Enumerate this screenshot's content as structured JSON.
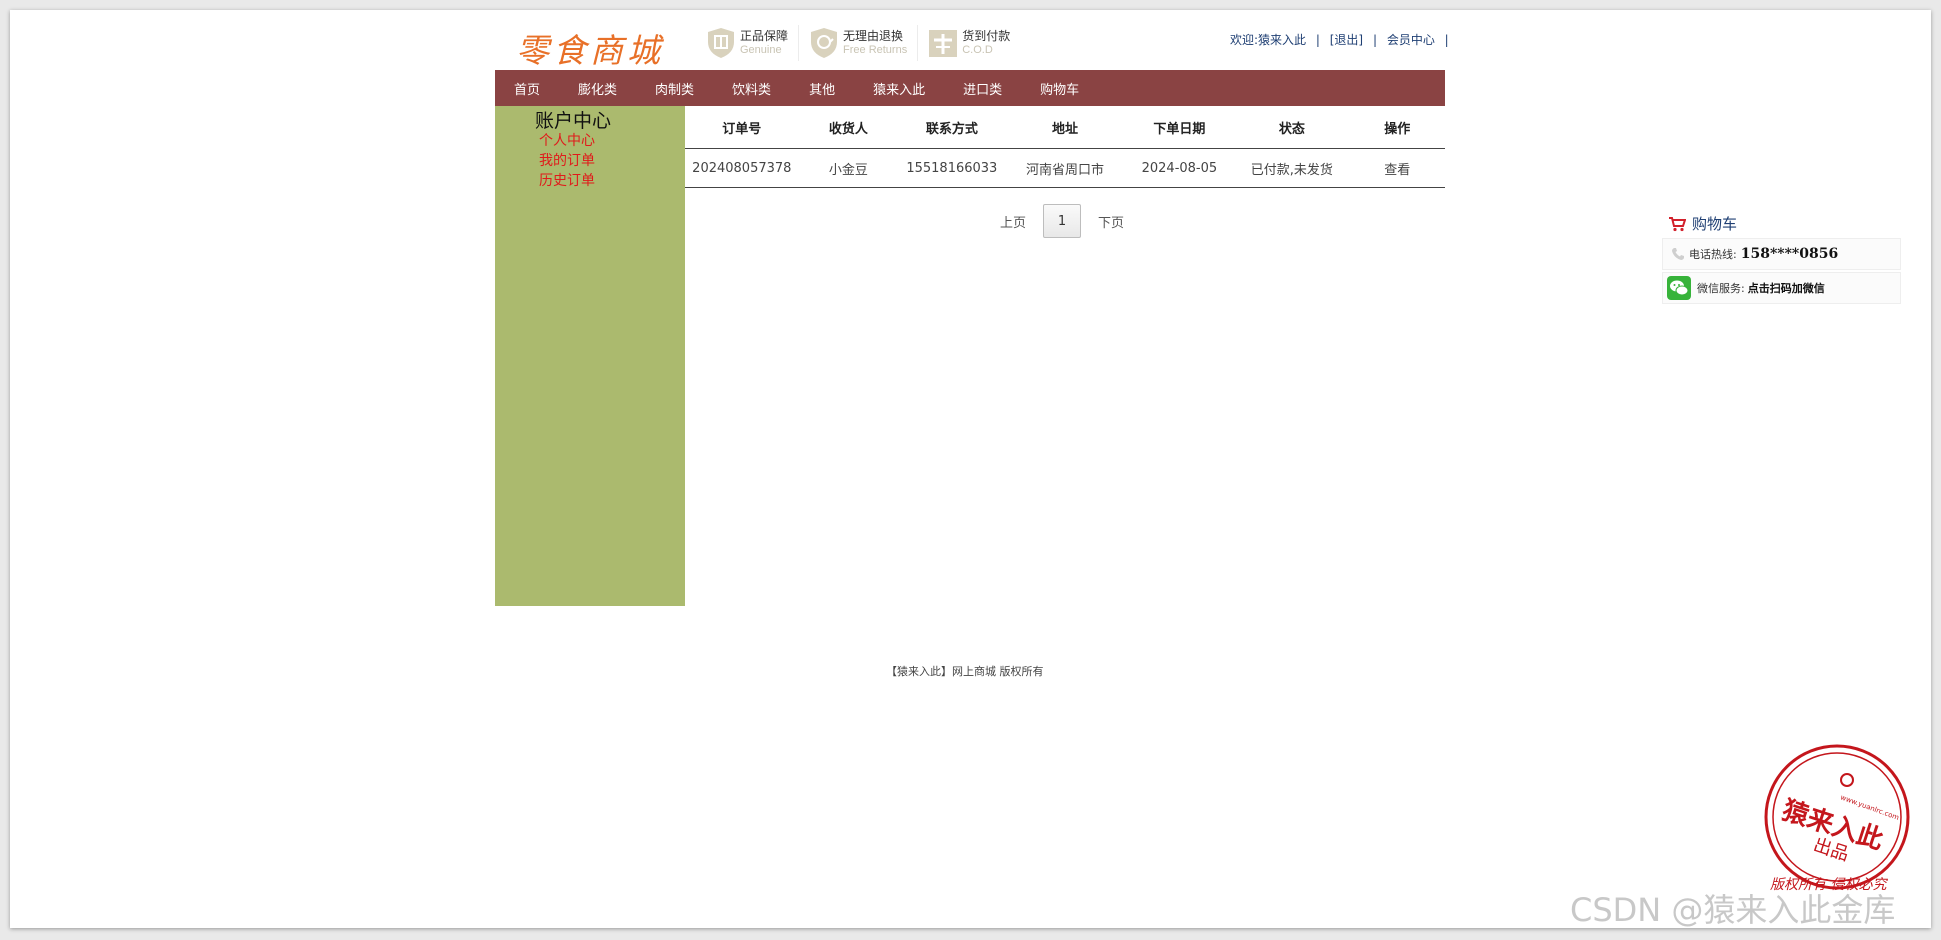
{
  "header": {
    "logo": "零食商城",
    "badges": [
      {
        "icon": "shield-genuine-icon",
        "title": "正品保障",
        "sub": "Genuine"
      },
      {
        "icon": "shield-return-icon",
        "title": "无理由退换",
        "sub": "Free Returns"
      },
      {
        "icon": "cod-icon",
        "title": "货到付款",
        "sub": "C.O.D"
      }
    ],
    "user": {
      "welcome": "欢迎:猿来入此",
      "logout": "[退出]",
      "member_center": "会员中心"
    }
  },
  "nav": [
    "首页",
    "膨化类",
    "肉制类",
    "饮料类",
    "其他",
    "猿来入此",
    "进口类",
    "购物车"
  ],
  "sidebar": {
    "title": "账户中心",
    "links": [
      "个人中心",
      "我的订单",
      "历史订单"
    ]
  },
  "orders": {
    "columns": [
      "订单号",
      "收货人",
      "联系方式",
      "地址",
      "下单日期",
      "状态",
      "操作"
    ],
    "rows": [
      [
        "202408057378",
        "小金豆",
        "15518166033",
        "河南省周口市",
        "2024-08-05",
        "已付款,未发货",
        "查看"
      ]
    ]
  },
  "pager": {
    "prev": "上页",
    "current": "1",
    "next": "下页"
  },
  "footer": "【猿来入此】网上商城 版权所有",
  "side_panel": {
    "cart": "购物车",
    "hotline_label": "电话热线:",
    "hotline_value": "158****0856",
    "wechat_label": "微信服务:",
    "wechat_value": "点击扫码加微信"
  },
  "stamp": {
    "name": "猿来入此",
    "sub": "出品",
    "url": "www.yuanlrc.com",
    "bottom": "版权所有 侵权必究"
  },
  "watermark": "CSDN @猿来入此金库",
  "colors": {
    "nav_bg": "#8a4343",
    "sidebar_bg": "#abba6e",
    "logo": "#e87028",
    "sidebar_link": "#e01b1b",
    "stamp": "#c4161c"
  }
}
